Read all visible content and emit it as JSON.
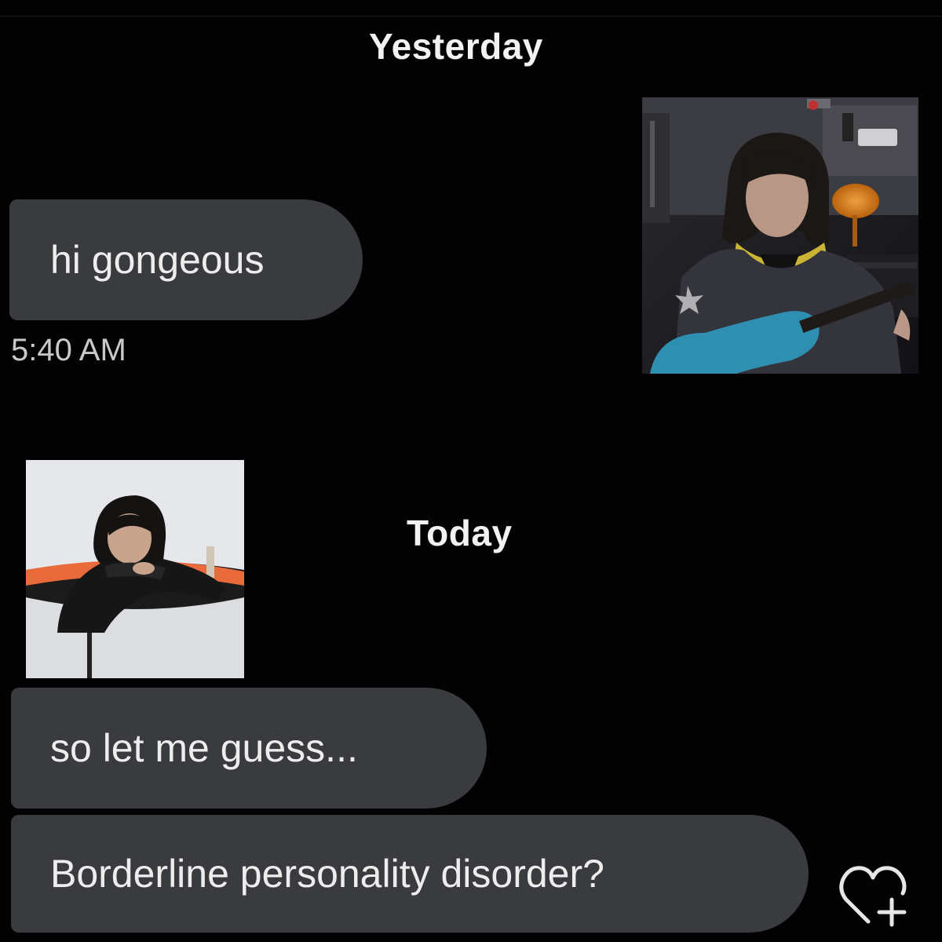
{
  "conversation": {
    "separators": {
      "yesterday": "Yesterday",
      "today": "Today"
    },
    "messages": [
      {
        "text": "hi gongeous",
        "timestamp": "5:40 AM"
      },
      {
        "text": "so let me guess..."
      },
      {
        "text": "Borderline personality disorder?"
      }
    ]
  },
  "stickers": [
    {
      "icon": "photo-person-playing-guitar"
    },
    {
      "icon": "photo-person-leaning-on-trampoline"
    }
  ],
  "actions": {
    "react_icon": "heart-plus-icon"
  },
  "colors": {
    "background": "#020202",
    "bubble": "#3a3b3f",
    "text": "#ededed",
    "timestamp": "#c9c9c9"
  }
}
